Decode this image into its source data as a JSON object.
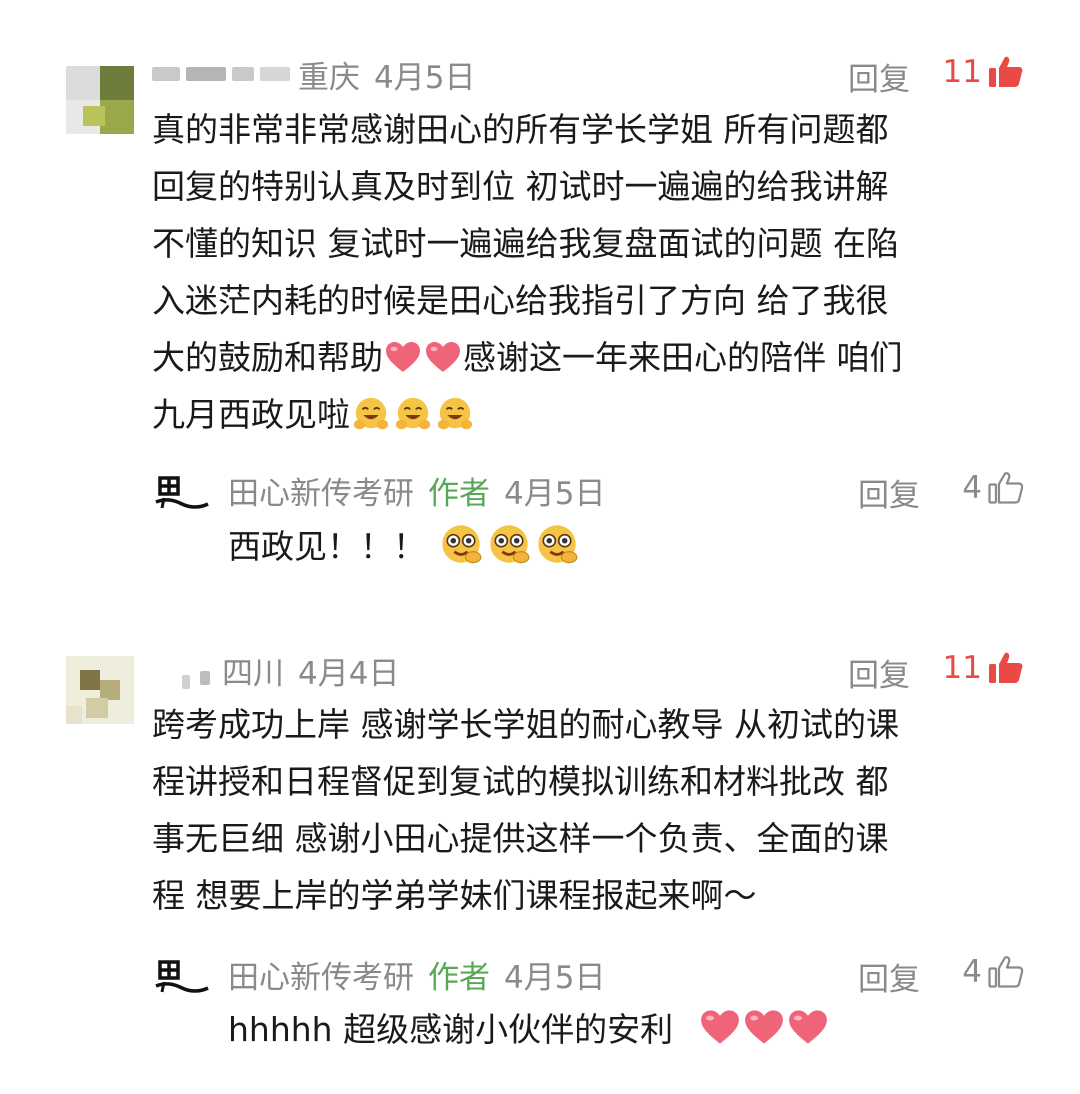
{
  "comments": [
    {
      "location": "重庆",
      "date": "4月5日",
      "reply_label": "回复",
      "likes": "11",
      "liked": true,
      "text_lines": [
        "真的非常非常感谢田心的所有学长学姐 所有问题都",
        "回复的特别认真及时到位 初试时一遍遍的给我讲解",
        "不懂的知识 复试时一遍遍给我复盘面试的问题 在陷",
        "入迷茫内耗的时候是田心给我指引了方向 给了我很"
      ],
      "line5_before": "大的鼓励和帮助",
      "line5_after": "感谢这一年来田心的陪伴 咱们",
      "line6": "九月西政见啦",
      "reply": {
        "author": "田心新传考研",
        "tag": "作者",
        "date": "4月5日",
        "reply_label": "回复",
        "likes": "4",
        "text": "西政见！！！"
      }
    },
    {
      "location": "四川",
      "date": "4月4日",
      "reply_label": "回复",
      "likes": "11",
      "liked": true,
      "text_lines": [
        "跨考成功上岸 感谢学长学姐的耐心教导 从初试的课",
        "程讲授和日程督促到复试的模拟训练和材料批改 都",
        "事无巨细 感谢小田心提供这样一个负责、全面的课",
        "程 想要上岸的学弟学妹们课程报起来啊～"
      ],
      "reply": {
        "author": "田心新传考研",
        "tag": "作者",
        "date": "4月5日",
        "reply_label": "回复",
        "likes": "4",
        "text": "hhhhh 超级感谢小伙伴的安利"
      }
    }
  ],
  "colors": {
    "meta_gray": "#8a8a8a",
    "like_red": "#e94a45",
    "author_green": "#57a957"
  }
}
